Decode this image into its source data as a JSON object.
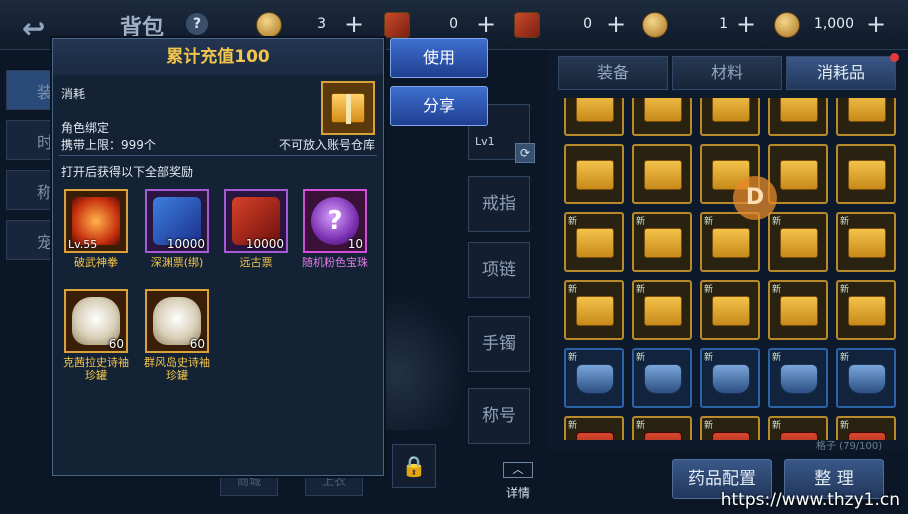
{
  "top_bar": {
    "title": "背包",
    "help": "?",
    "currencies": [
      {
        "icon": "coin-icon",
        "value": "3"
      },
      {
        "icon": "ticket-icon",
        "value": "0"
      },
      {
        "icon": "scroll-icon",
        "value": "0"
      },
      {
        "icon": "token-icon",
        "value": "1"
      },
      {
        "icon": "gold-icon",
        "value": "1,000"
      }
    ],
    "plus": "+"
  },
  "left_tabs": [
    "装",
    "时",
    "称",
    "宠"
  ],
  "equipment_slots": {
    "weapon_level": "Lv1",
    "ring": "戒指",
    "necklace": "项链",
    "bracelet": "手镯",
    "title": "称号",
    "detail": "详情",
    "ghost_1": "商城",
    "ghost_2": "上衣"
  },
  "popup": {
    "title": "累计充值100",
    "type": "消耗",
    "binding": "角色绑定",
    "limit": "携带上限：999个",
    "warehouse": "不可放入账号仓库",
    "reward_header": "打开后获得以下全部奖励",
    "rewards": [
      {
        "name": "破武神拳",
        "badge": "Lv.55",
        "art": "fire",
        "tier": "orange"
      },
      {
        "name": "深渊票(绑)",
        "badge": "10000",
        "art": "scroll-blue",
        "tier": "purple"
      },
      {
        "name": "远古票",
        "badge": "10000",
        "art": "scroll-red",
        "tier": "purple"
      },
      {
        "name": "随机粉色宝珠",
        "badge": "10",
        "art": "gem",
        "tier": "pink"
      },
      {
        "name": "克茜拉史诗袖珍罐",
        "badge": "60",
        "art": "jar",
        "tier": "orange"
      },
      {
        "name": "群风岛史诗袖珍罐",
        "badge": "60",
        "art": "jar",
        "tier": "orange"
      }
    ]
  },
  "actions": {
    "use": "使用",
    "share": "分享"
  },
  "inventory": {
    "tabs": [
      "装备",
      "材料",
      "消耗品"
    ],
    "active_tab": "消耗品",
    "scroll_letter": "D",
    "capacity": "格子 (79/100)",
    "potion_config": "药品配置",
    "sort": "整 理",
    "new_label": "新"
  },
  "watermark": "https://www.thzy1.cn",
  "colors": {
    "title_gold": "#f2c54c",
    "pink": "#e07ae6",
    "accent_blue": "#3e6fd0"
  }
}
